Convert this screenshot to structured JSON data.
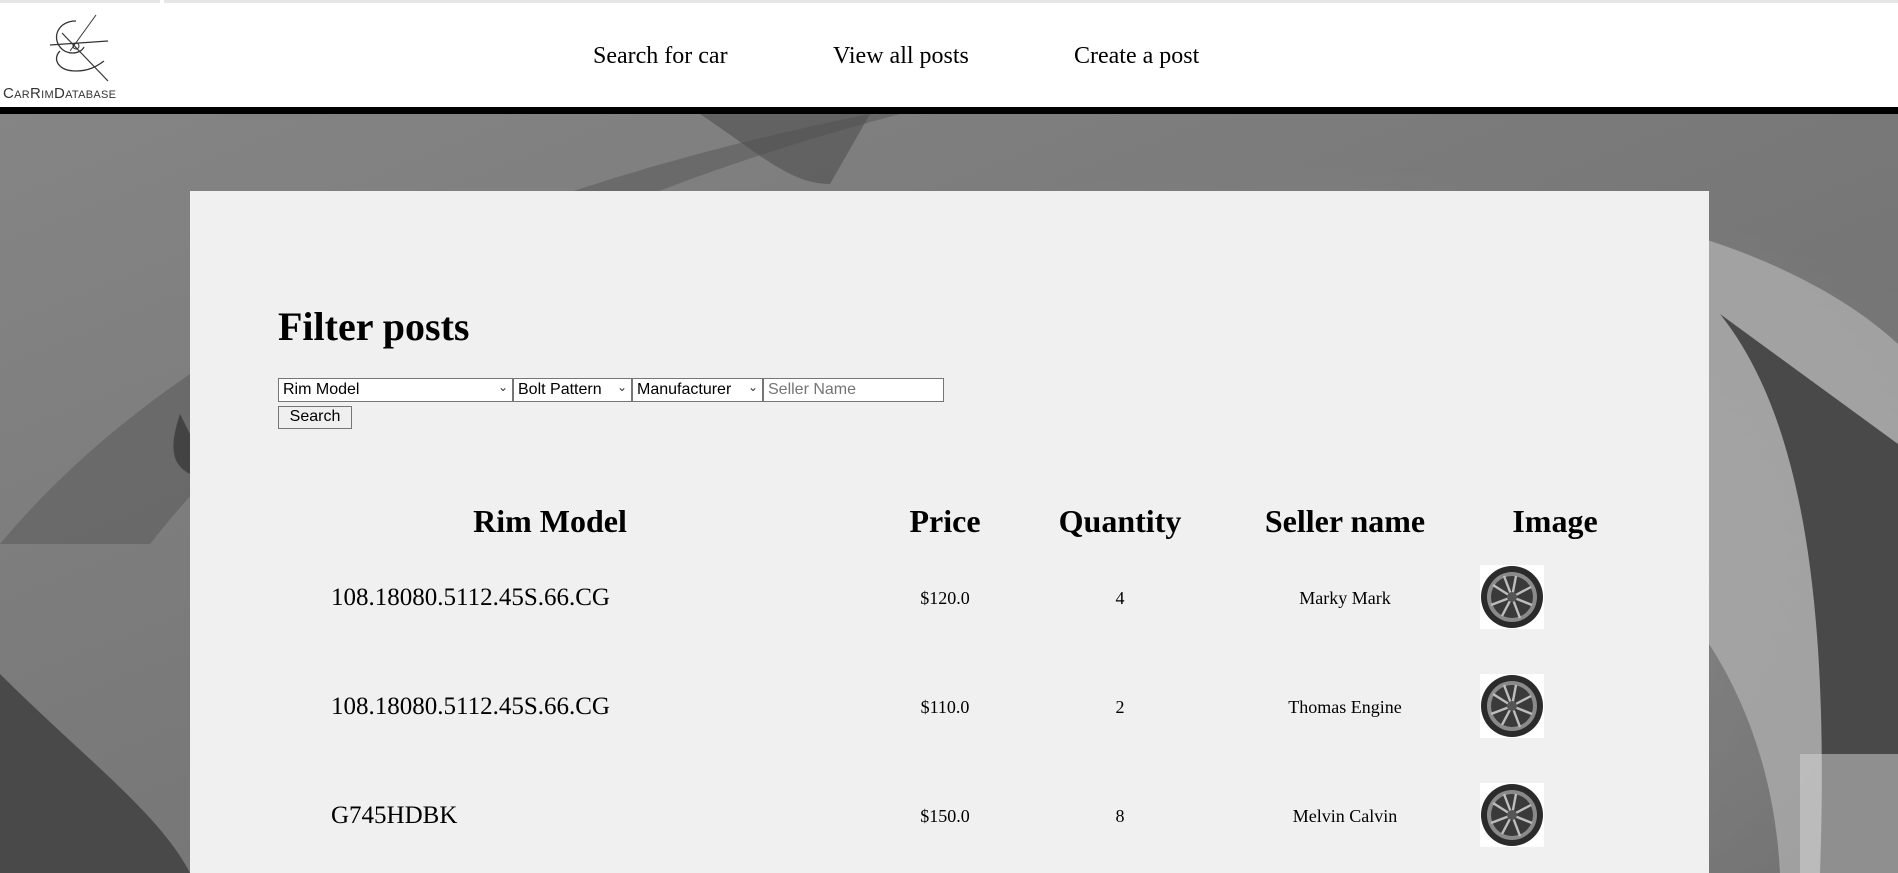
{
  "brand": {
    "logo_text": "CarRimDatabase"
  },
  "nav": [
    {
      "label": "Search for car"
    },
    {
      "label": "View all posts"
    },
    {
      "label": "Create a post"
    }
  ],
  "filter": {
    "title": "Filter posts",
    "rim_model": "Rim Model",
    "bolt_pattern": "Bolt Pattern",
    "manufacturer": "Manufacturer",
    "seller_placeholder": "Seller Name",
    "search_label": "Search"
  },
  "table": {
    "headers": [
      "Rim Model",
      "Price",
      "Quantity",
      "Seller name",
      "Image"
    ],
    "rows": [
      {
        "model": "108.18080.5112.45S.66.CG",
        "price": "$120.0",
        "quantity": "4",
        "seller": "Marky Mark"
      },
      {
        "model": "108.18080.5112.45S.66.CG",
        "price": "$110.0",
        "quantity": "2",
        "seller": "Thomas Engine"
      },
      {
        "model": "G745HDBK",
        "price": "$150.0",
        "quantity": "8",
        "seller": "Melvin Calvin"
      }
    ]
  },
  "colors": {
    "panel": "#f0f0f0",
    "header_rule": "#000000",
    "background": "#9a9a9a"
  },
  "icons": [
    "logo-icon",
    "chevron-down-icon",
    "rim-image-icon"
  ]
}
